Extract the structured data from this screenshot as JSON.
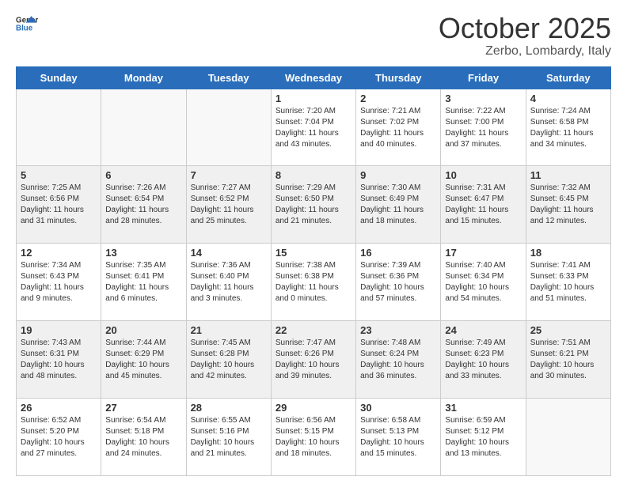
{
  "header": {
    "logo_general": "General",
    "logo_blue": "Blue",
    "title": "October 2025",
    "location": "Zerbo, Lombardy, Italy"
  },
  "weekdays": [
    "Sunday",
    "Monday",
    "Tuesday",
    "Wednesday",
    "Thursday",
    "Friday",
    "Saturday"
  ],
  "weeks": [
    [
      {
        "day": "",
        "empty": true
      },
      {
        "day": "",
        "empty": true
      },
      {
        "day": "",
        "empty": true
      },
      {
        "day": "1",
        "sunrise": "7:20 AM",
        "sunset": "7:04 PM",
        "daylight": "11 hours and 43 minutes."
      },
      {
        "day": "2",
        "sunrise": "7:21 AM",
        "sunset": "7:02 PM",
        "daylight": "11 hours and 40 minutes."
      },
      {
        "day": "3",
        "sunrise": "7:22 AM",
        "sunset": "7:00 PM",
        "daylight": "11 hours and 37 minutes."
      },
      {
        "day": "4",
        "sunrise": "7:24 AM",
        "sunset": "6:58 PM",
        "daylight": "11 hours and 34 minutes."
      }
    ],
    [
      {
        "day": "5",
        "sunrise": "7:25 AM",
        "sunset": "6:56 PM",
        "daylight": "11 hours and 31 minutes."
      },
      {
        "day": "6",
        "sunrise": "7:26 AM",
        "sunset": "6:54 PM",
        "daylight": "11 hours and 28 minutes."
      },
      {
        "day": "7",
        "sunrise": "7:27 AM",
        "sunset": "6:52 PM",
        "daylight": "11 hours and 25 minutes."
      },
      {
        "day": "8",
        "sunrise": "7:29 AM",
        "sunset": "6:50 PM",
        "daylight": "11 hours and 21 minutes."
      },
      {
        "day": "9",
        "sunrise": "7:30 AM",
        "sunset": "6:49 PM",
        "daylight": "11 hours and 18 minutes."
      },
      {
        "day": "10",
        "sunrise": "7:31 AM",
        "sunset": "6:47 PM",
        "daylight": "11 hours and 15 minutes."
      },
      {
        "day": "11",
        "sunrise": "7:32 AM",
        "sunset": "6:45 PM",
        "daylight": "11 hours and 12 minutes."
      }
    ],
    [
      {
        "day": "12",
        "sunrise": "7:34 AM",
        "sunset": "6:43 PM",
        "daylight": "11 hours and 9 minutes."
      },
      {
        "day": "13",
        "sunrise": "7:35 AM",
        "sunset": "6:41 PM",
        "daylight": "11 hours and 6 minutes."
      },
      {
        "day": "14",
        "sunrise": "7:36 AM",
        "sunset": "6:40 PM",
        "daylight": "11 hours and 3 minutes."
      },
      {
        "day": "15",
        "sunrise": "7:38 AM",
        "sunset": "6:38 PM",
        "daylight": "11 hours and 0 minutes."
      },
      {
        "day": "16",
        "sunrise": "7:39 AM",
        "sunset": "6:36 PM",
        "daylight": "10 hours and 57 minutes."
      },
      {
        "day": "17",
        "sunrise": "7:40 AM",
        "sunset": "6:34 PM",
        "daylight": "10 hours and 54 minutes."
      },
      {
        "day": "18",
        "sunrise": "7:41 AM",
        "sunset": "6:33 PM",
        "daylight": "10 hours and 51 minutes."
      }
    ],
    [
      {
        "day": "19",
        "sunrise": "7:43 AM",
        "sunset": "6:31 PM",
        "daylight": "10 hours and 48 minutes."
      },
      {
        "day": "20",
        "sunrise": "7:44 AM",
        "sunset": "6:29 PM",
        "daylight": "10 hours and 45 minutes."
      },
      {
        "day": "21",
        "sunrise": "7:45 AM",
        "sunset": "6:28 PM",
        "daylight": "10 hours and 42 minutes."
      },
      {
        "day": "22",
        "sunrise": "7:47 AM",
        "sunset": "6:26 PM",
        "daylight": "10 hours and 39 minutes."
      },
      {
        "day": "23",
        "sunrise": "7:48 AM",
        "sunset": "6:24 PM",
        "daylight": "10 hours and 36 minutes."
      },
      {
        "day": "24",
        "sunrise": "7:49 AM",
        "sunset": "6:23 PM",
        "daylight": "10 hours and 33 minutes."
      },
      {
        "day": "25",
        "sunrise": "7:51 AM",
        "sunset": "6:21 PM",
        "daylight": "10 hours and 30 minutes."
      }
    ],
    [
      {
        "day": "26",
        "sunrise": "6:52 AM",
        "sunset": "5:20 PM",
        "daylight": "10 hours and 27 minutes."
      },
      {
        "day": "27",
        "sunrise": "6:54 AM",
        "sunset": "5:18 PM",
        "daylight": "10 hours and 24 minutes."
      },
      {
        "day": "28",
        "sunrise": "6:55 AM",
        "sunset": "5:16 PM",
        "daylight": "10 hours and 21 minutes."
      },
      {
        "day": "29",
        "sunrise": "6:56 AM",
        "sunset": "5:15 PM",
        "daylight": "10 hours and 18 minutes."
      },
      {
        "day": "30",
        "sunrise": "6:58 AM",
        "sunset": "5:13 PM",
        "daylight": "10 hours and 15 minutes."
      },
      {
        "day": "31",
        "sunrise": "6:59 AM",
        "sunset": "5:12 PM",
        "daylight": "10 hours and 13 minutes."
      },
      {
        "day": "",
        "empty": true
      }
    ]
  ],
  "labels": {
    "sunrise": "Sunrise:",
    "sunset": "Sunset:",
    "daylight": "Daylight:"
  },
  "accent_color": "#2a6ebb"
}
